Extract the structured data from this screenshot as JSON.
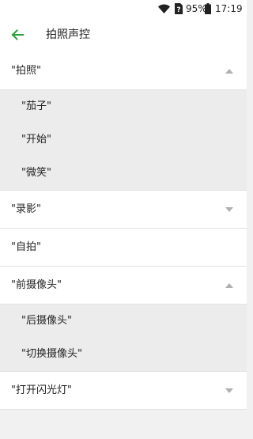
{
  "status_bar": {
    "battery_percent": "95%",
    "time": "17:19"
  },
  "app_bar": {
    "title": "拍照声控"
  },
  "groups": [
    {
      "label": "\"拍照\"",
      "expanded": true,
      "items": [
        "\"茄子\"",
        "\"开始\"",
        "\"微笑\""
      ]
    },
    {
      "label": "\"录影\"",
      "expanded": false,
      "items": []
    },
    {
      "label": "\"自拍\"",
      "expanded": false,
      "items": []
    },
    {
      "label": "\"前摄像头\"",
      "expanded": true,
      "items": [
        "\"后摄像头\"",
        "\"切换摄像头\""
      ]
    },
    {
      "label": "\"打开闪光灯\"",
      "expanded": false,
      "items": []
    }
  ],
  "colors": {
    "accent": "#2e9d3a",
    "chevron": "#b0b0b0"
  }
}
